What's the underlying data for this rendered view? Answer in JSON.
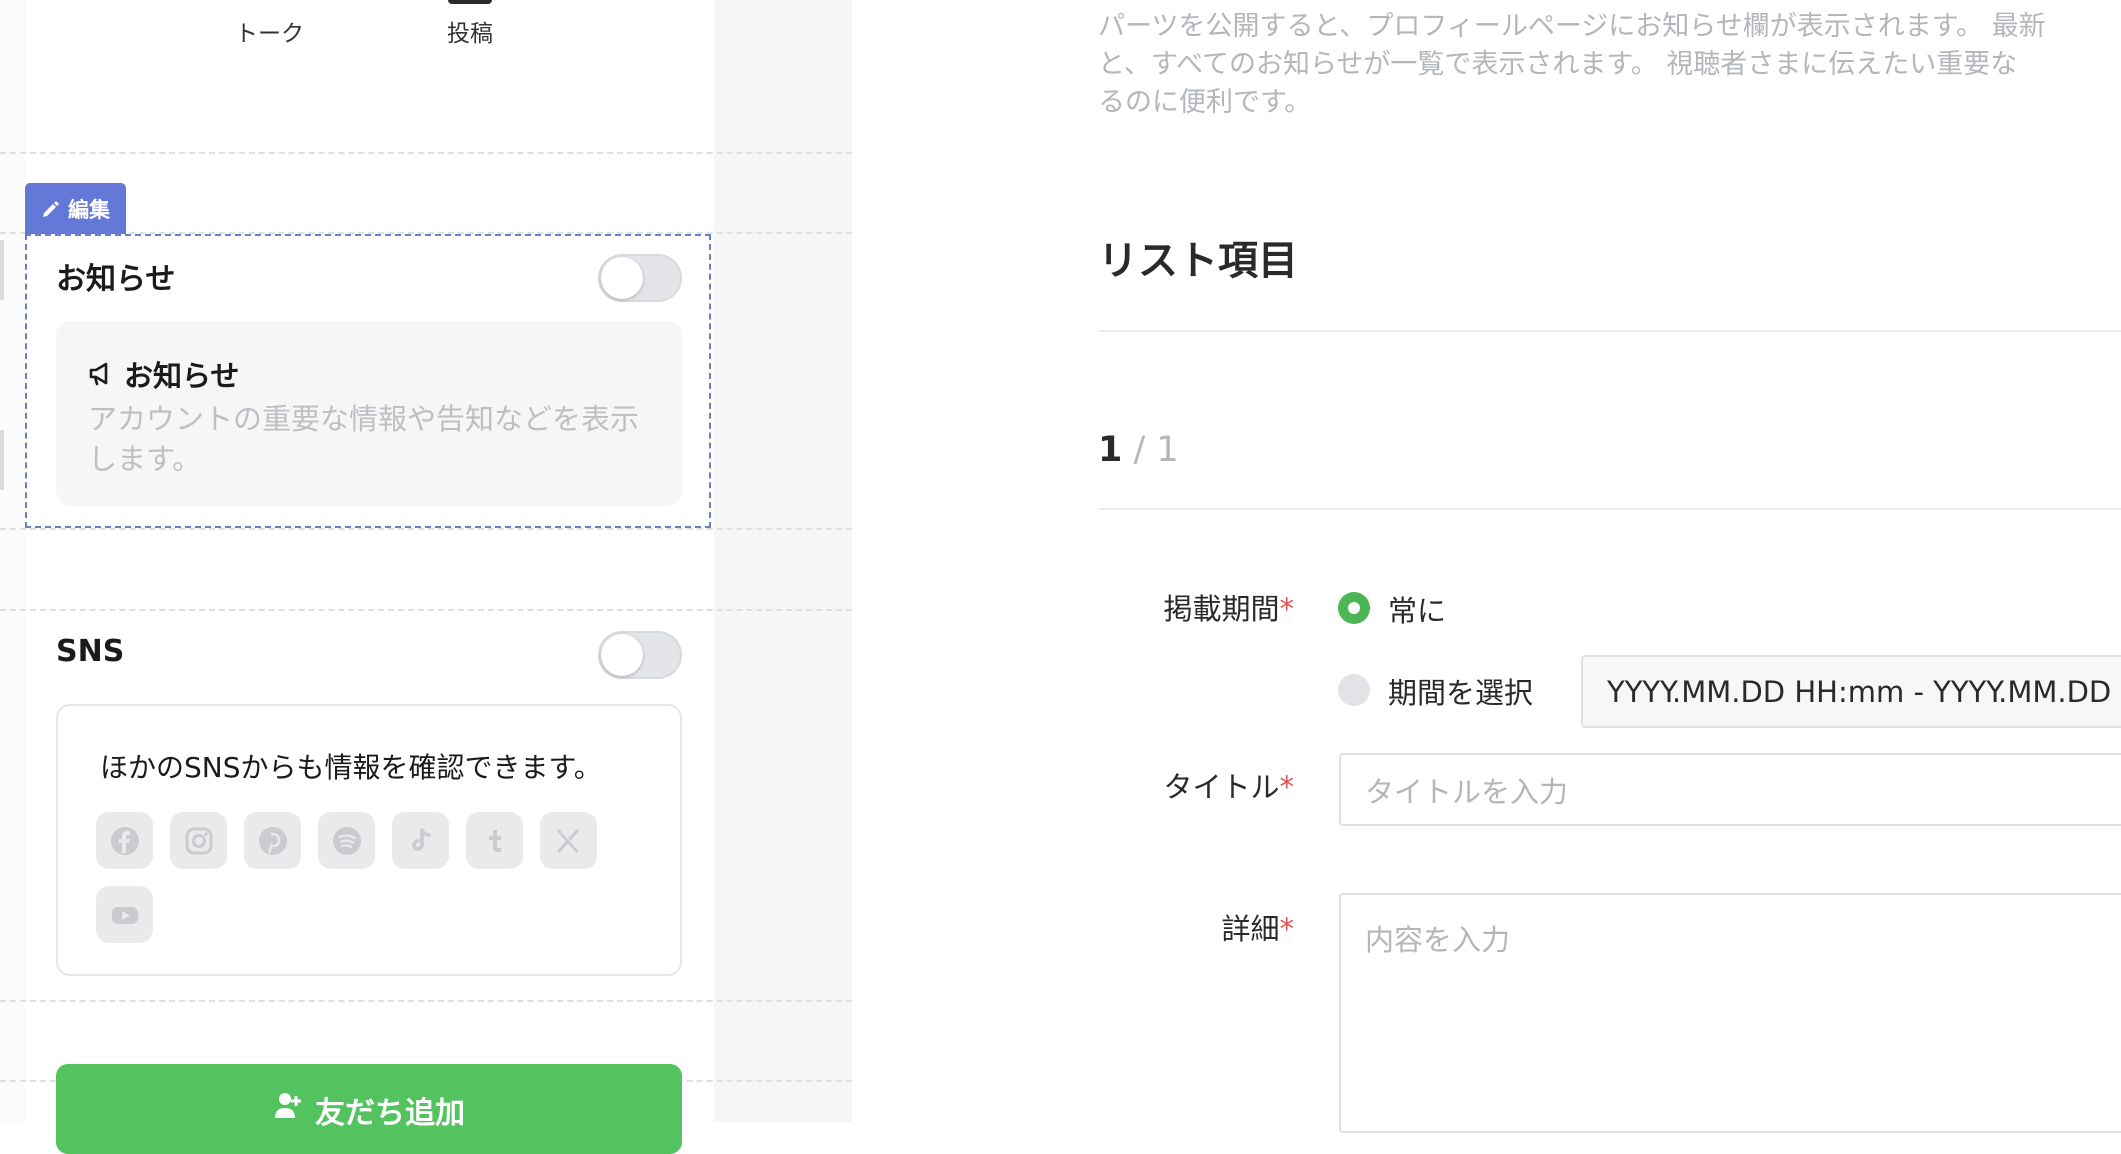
{
  "nav": {
    "talk_label": "トーク",
    "post_label": "投稿"
  },
  "edit_tag": {
    "label": "編集"
  },
  "notice_section": {
    "title": "お知らせ",
    "toggle_on": false,
    "card_title": "お知らせ",
    "card_desc": "アカウントの重要な情報や告知などを表示します。"
  },
  "sns_section": {
    "title": "SNS",
    "toggle_on": false,
    "card_text": "ほかのSNSからも情報を確認できます。",
    "icons": [
      "facebook-icon",
      "instagram-icon",
      "pinterest-icon",
      "spotify-icon",
      "tiktok-icon",
      "tumblr-icon",
      "x-icon",
      "youtube-icon"
    ]
  },
  "friend_button": {
    "label": "友だち追加"
  },
  "editor": {
    "description_lines": [
      "パーツを公開すると、プロフィールページにお知らせ欄が表示されます。 最新",
      "と、すべてのお知らせが一覧で表示されます。 視聴者さまに伝えたい重要な",
      "るのに便利です。"
    ],
    "list_heading": "リスト項目",
    "pager": {
      "current": "1",
      "total": " / 1"
    },
    "period": {
      "label": "掲載期間",
      "required_mark": "*",
      "option_always": "常に",
      "option_select": "期間を選択",
      "selected": "always",
      "range_value": "YYYY.MM.DD HH:mm - YYYY.MM.DD HH:mm"
    },
    "title_field": {
      "label": "タイトル",
      "required_mark": "*",
      "placeholder": "タイトルを入力"
    },
    "detail_field": {
      "label": "詳細",
      "required_mark": "*",
      "placeholder": "内容を入力"
    }
  },
  "colors": {
    "accent_green": "#53c35f",
    "edit_tag_blue": "#6478d8",
    "required_red": "#e05252"
  }
}
